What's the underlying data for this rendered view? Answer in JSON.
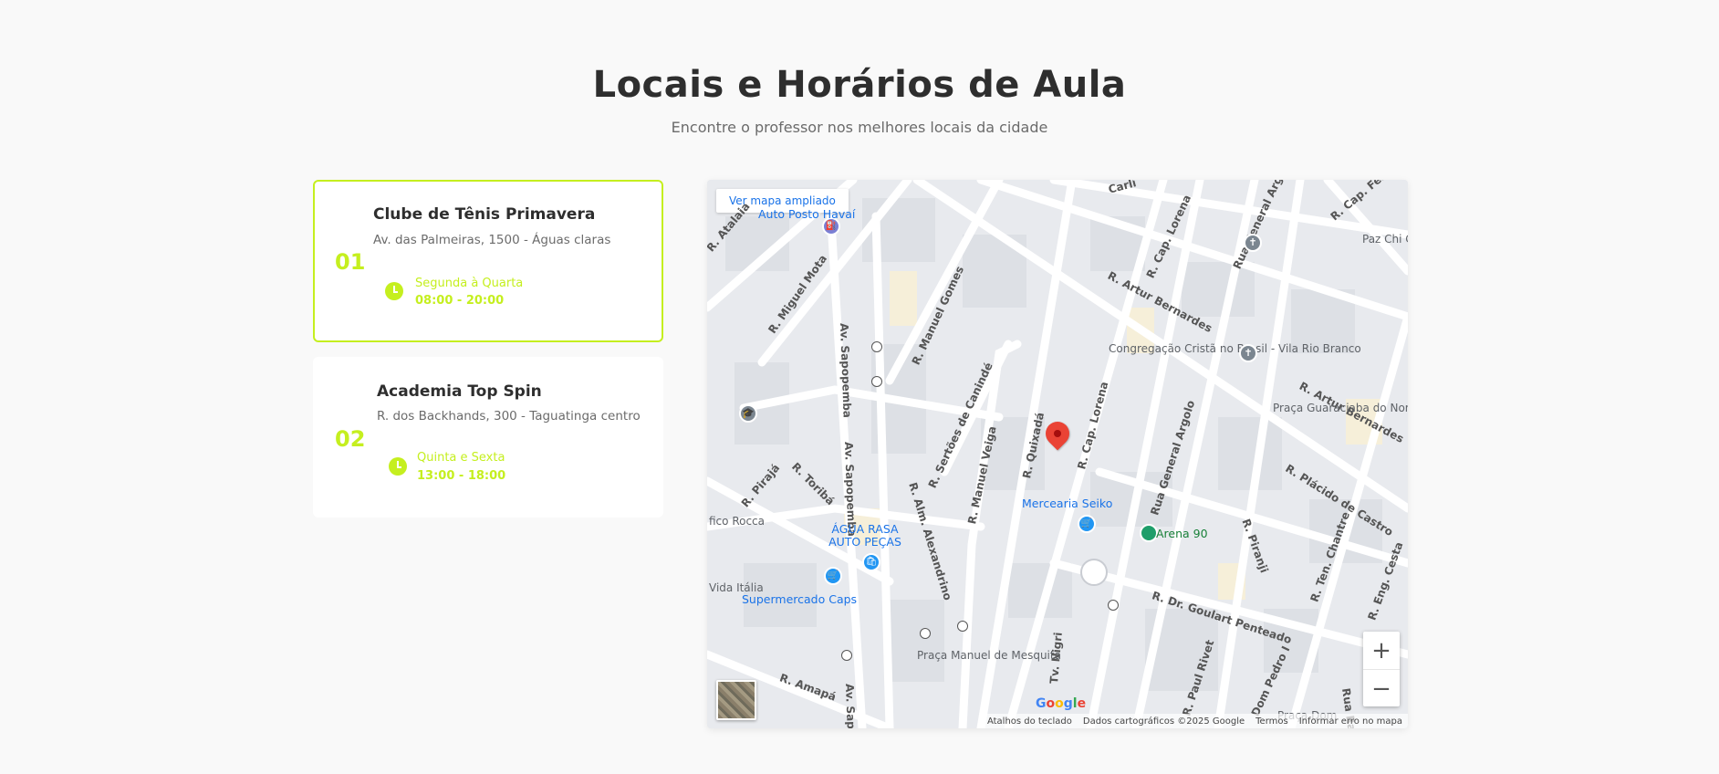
{
  "header": {
    "title": "Locais e Horários de Aula",
    "subtitle": "Encontre o professor nos melhores locais da cidade"
  },
  "locations": [
    {
      "number": "01",
      "name": "Clube de Tênis Primavera",
      "address": "Av. das Palmeiras, 1500 - Águas claras",
      "days": "Segunda à Quarta",
      "hours": "08:00 - 20:00",
      "active": true
    },
    {
      "number": "02",
      "name": "Academia Top Spin",
      "address": "R. dos Backhands, 300 - Taguatinga centro",
      "days": "Quinta e Sexta",
      "hours": "13:00 - 18:00",
      "active": false
    }
  ],
  "map": {
    "larger_map_link": "Ver mapa ampliado",
    "zoom_in": "+",
    "zoom_out": "−",
    "attribution": {
      "shortcuts": "Atalhos do teclado",
      "data": "Dados cartográficos ©2025 Google",
      "terms": "Termos",
      "report": "Informar erro no mapa"
    },
    "google_logo": [
      "G",
      "o",
      "o",
      "g",
      "l",
      "e"
    ],
    "pois": {
      "posto": "Auto Posto Havaí",
      "mercearia": "Mercearia Seiko",
      "arena": "Arena 90",
      "agua_rasa": "ÁGUA RASA AUTO PEÇAS",
      "supermercado": "Supermercado Caps",
      "congregacao": "Congregação Cristã no Brasil - Vila Rio Branco",
      "paz": "Paz Chi Campus",
      "praca_guaraciaba": "Praça Guaraciaba do Norte",
      "praca_manuel": "Praça Manuel de Mesquita",
      "fico_rocca": "fico Rocca",
      "vida_italia": "Vida Itália",
      "praca_dom": "Praça Dom"
    },
    "streets": {
      "atalaia": "R. Atalaia",
      "miguel_mota": "R. Miguel Mota",
      "sapopemba1": "Av. Sapopemba",
      "sapopemba2": "Av. Sapopemba",
      "sapopemba3": "Av. Sapop",
      "manuel_gomes": "R. Manuel Gomes",
      "artur1": "R. Artur Bernardes",
      "artur2": "R. Artur Bernardes",
      "cap_lorena1": "R. Cap. Lorena",
      "cap_lorena2": "R. Cap. Lorena",
      "general_argolo1": "Rua General Argolo",
      "general_argolo2": "Rua General Argolo",
      "cap_ferraiu": "R. Cap. Ferraiu",
      "sertoes": "R. Sertões de Canindé",
      "manuel_veiga": "R. Manuel Veiga",
      "quixada": "R. Quixadá",
      "alexandrino": "R. Alm. Alexandrino",
      "toriba": "R. Toribá",
      "piraja": "R. Pirajá",
      "placido": "R. Plácido de Castro",
      "piranji": "R. Piranji",
      "ten_chantre": "R. Ten. Chantre",
      "eng_cesta": "R. Eng. Cesta",
      "goulart": "R. Dr. Goulart Penteado",
      "amapa": "R. Amapá",
      "paul_rivet": "R. Paul Rivet",
      "dom_pedro": "Dom Pedro I",
      "raimun": "Rua Raimun",
      "nigri": "Tv. Nigri",
      "carli": "Carli"
    }
  }
}
